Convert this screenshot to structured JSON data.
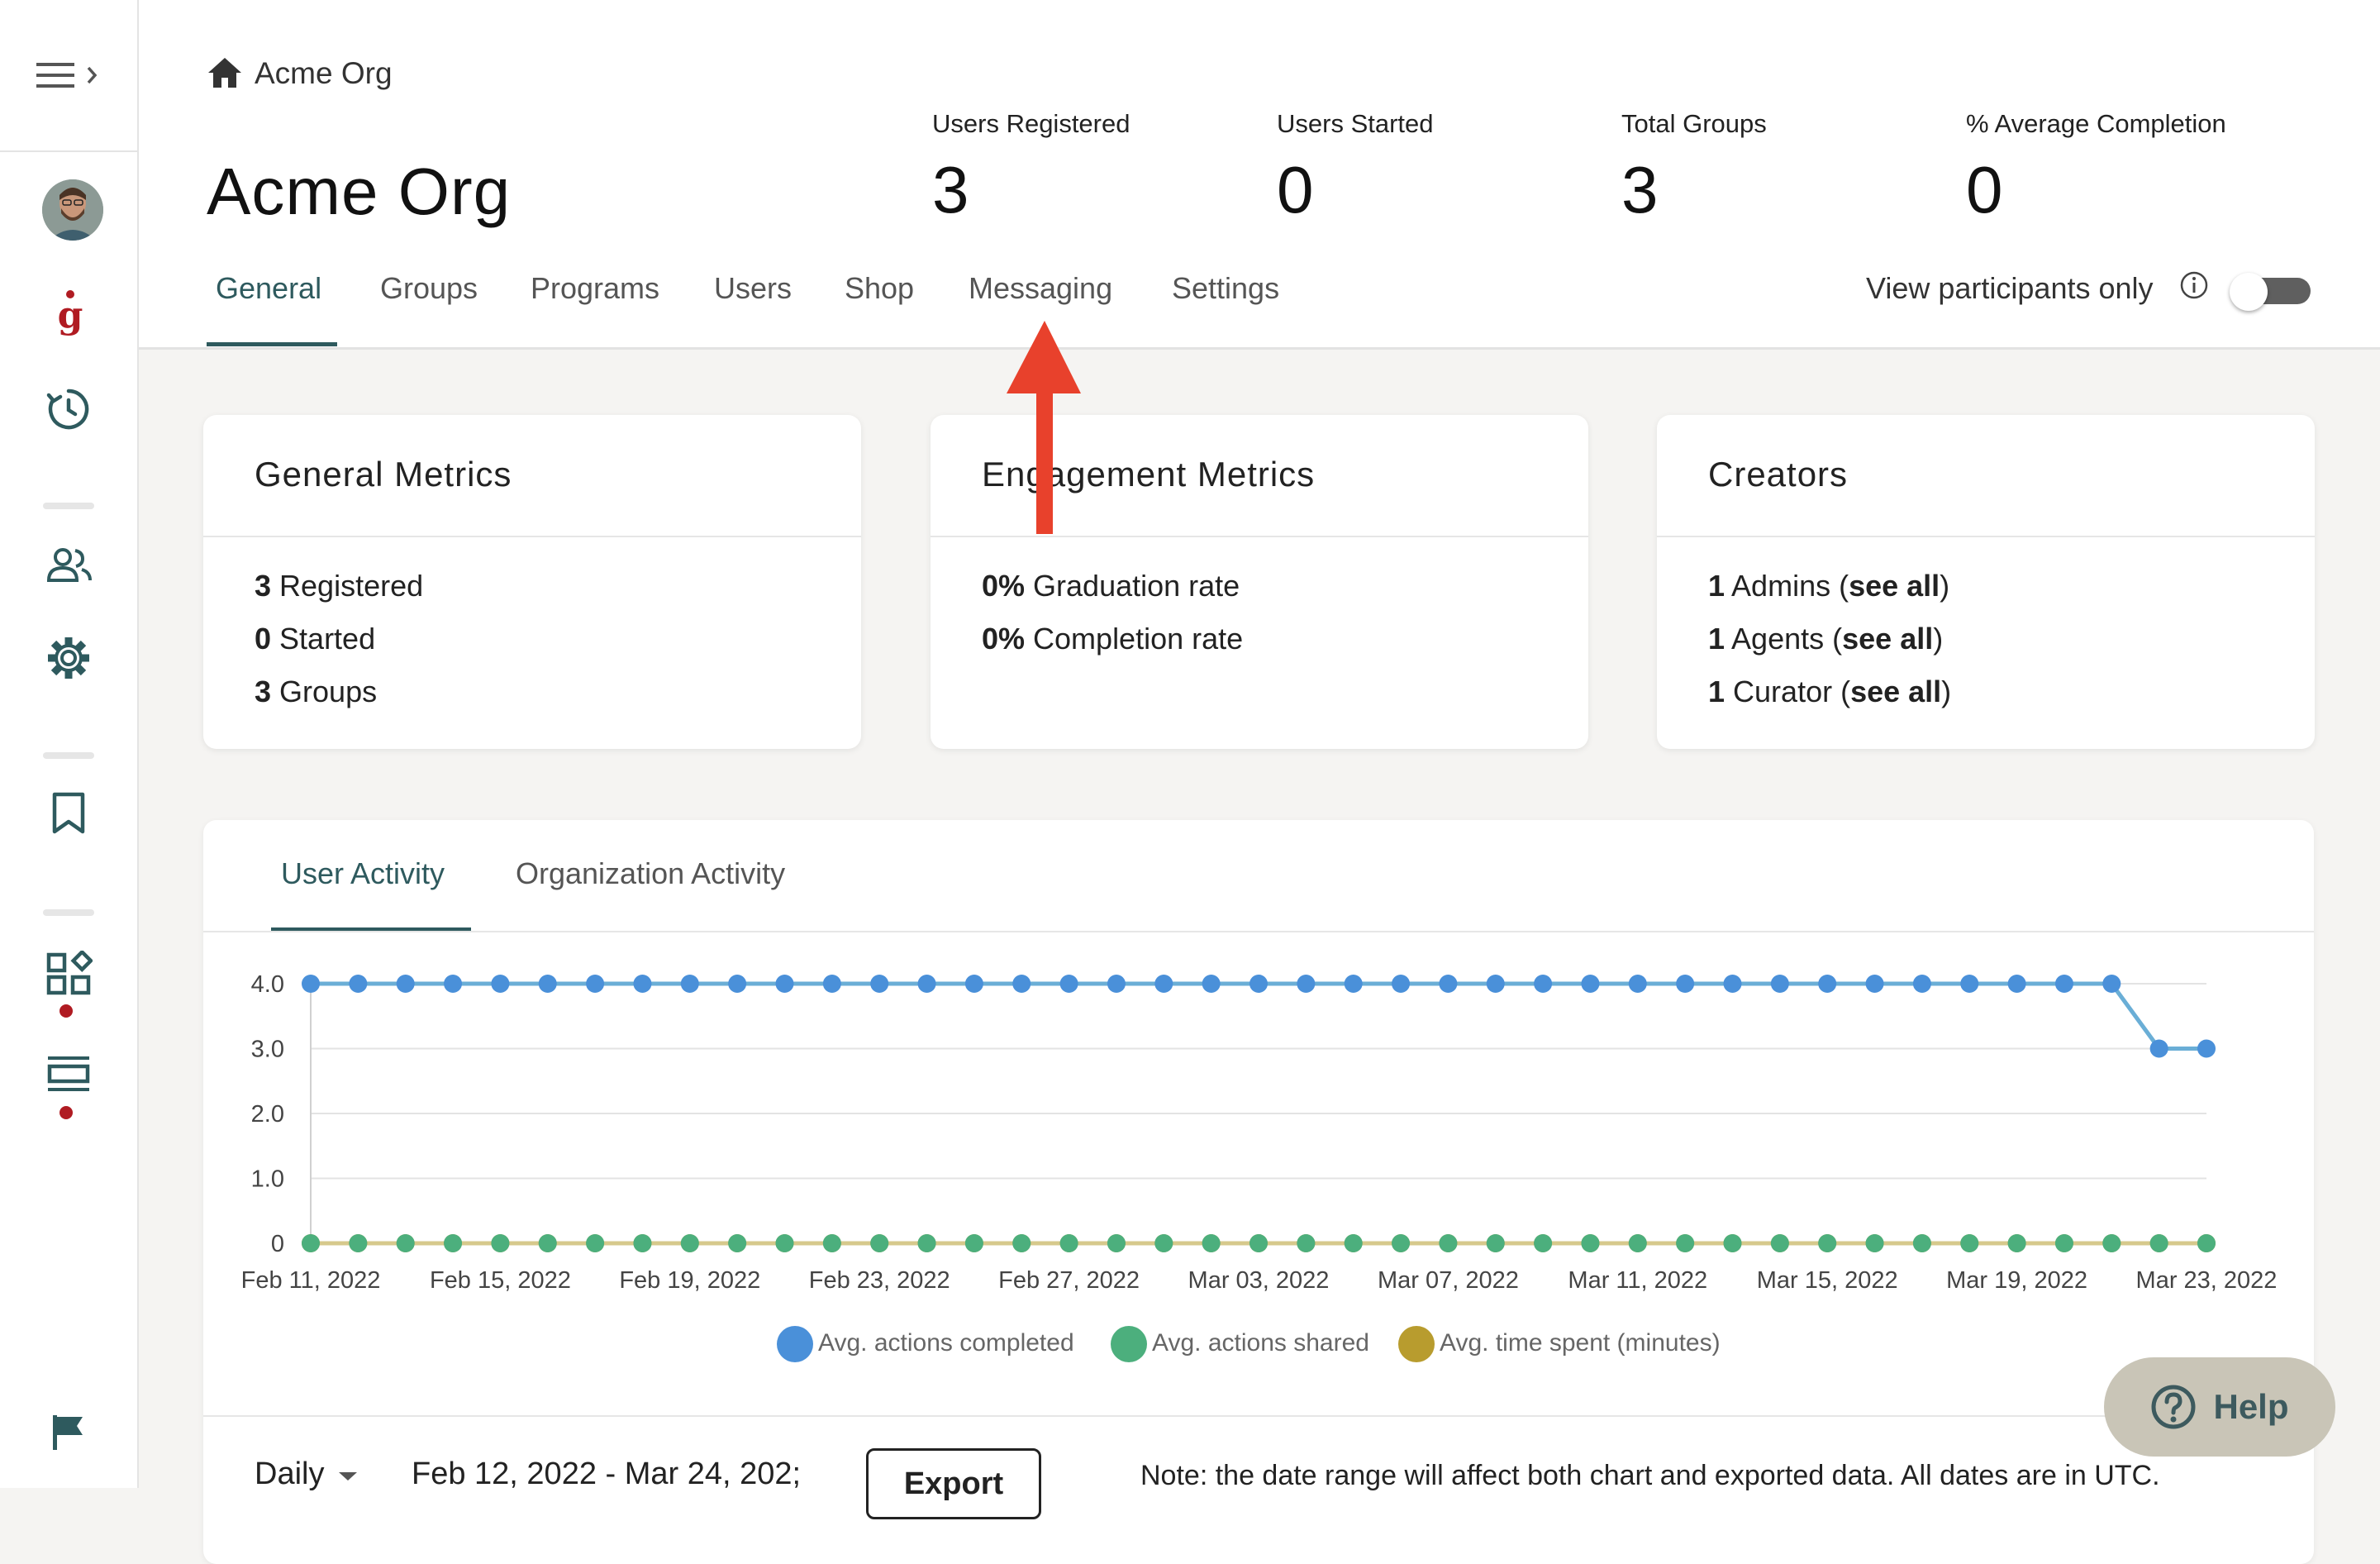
{
  "sidebar": {
    "menu_icon": "menu-expand-icon",
    "items": [
      {
        "name": "avatar"
      },
      {
        "name": "g-logo-icon"
      },
      {
        "name": "history-icon"
      },
      {
        "name": "people-icon"
      },
      {
        "name": "gear-icon"
      },
      {
        "name": "bookmark-icon"
      },
      {
        "name": "widgets-icon"
      },
      {
        "name": "layout-icon"
      },
      {
        "name": "flag-icon"
      }
    ],
    "accent": "#b01b22",
    "icon_color": "#2e5a5e"
  },
  "breadcrumb": {
    "icon": "home-icon",
    "label": "Acme Org"
  },
  "page_title": "Acme Org",
  "stats": [
    {
      "label": "Users Registered",
      "value": "3"
    },
    {
      "label": "Users Started",
      "value": "0"
    },
    {
      "label": "Total Groups",
      "value": "3"
    },
    {
      "label": "% Average Completion",
      "value": "0"
    }
  ],
  "tabs": [
    "General",
    "Groups",
    "Programs",
    "Users",
    "Shop",
    "Messaging",
    "Settings"
  ],
  "active_tab": "General",
  "participants_toggle": {
    "label": "View participants only",
    "info_icon": "info-icon",
    "on": false
  },
  "cards": {
    "general": {
      "title": "General Metrics",
      "lines": [
        {
          "num": "3",
          "text": " Registered"
        },
        {
          "num": "0",
          "text": " Started"
        },
        {
          "num": "3",
          "text": " Groups"
        }
      ]
    },
    "engagement": {
      "title": "Engagement Metrics",
      "lines": [
        {
          "num": "0%",
          "text": " Graduation rate"
        },
        {
          "num": "0%",
          "text": " Completion rate"
        }
      ]
    },
    "creators": {
      "title": "Creators",
      "lines": [
        {
          "num": "1",
          "text": " Admins  (",
          "link": "see all",
          "close": ")"
        },
        {
          "num": "1",
          "text": " Agents  (",
          "link": "see all",
          "close": ")"
        },
        {
          "num": "1",
          "text": " Curator  (",
          "link": "see all",
          "close": ")"
        }
      ]
    }
  },
  "activity_tabs": [
    "User Activity",
    "Organization Activity"
  ],
  "chart_data": {
    "type": "line",
    "x_start": "Feb 11, 2022",
    "x_end": "Mar 23, 2022",
    "x_tick_labels": [
      "Feb 11, 2022",
      "Feb 15, 2022",
      "Feb 19, 2022",
      "Feb 23, 2022",
      "Feb 27, 2022",
      "Mar 03, 2022",
      "Mar 07, 2022",
      "Mar 11, 2022",
      "Mar 15, 2022",
      "Mar 19, 2022",
      "Mar 23, 2022"
    ],
    "y_tick_labels": [
      "4.0",
      "3.0",
      "2.0",
      "1.0",
      "0"
    ],
    "ylim": [
      0,
      4
    ],
    "grid": true,
    "legend_position": "bottom",
    "series": [
      {
        "name": "Avg. actions completed",
        "color": "#4a90d9",
        "line_color": "#6aaed6",
        "values": [
          4,
          4,
          4,
          4,
          4,
          4,
          4,
          4,
          4,
          4,
          4,
          4,
          4,
          4,
          4,
          4,
          4,
          4,
          4,
          4,
          4,
          4,
          4,
          4,
          4,
          4,
          4,
          4,
          4,
          4,
          4,
          4,
          4,
          4,
          4,
          4,
          4,
          4,
          4,
          3,
          3
        ]
      },
      {
        "name": "Avg. actions shared",
        "color": "#4caf7d",
        "line_color": "#4caf7d",
        "values": [
          0,
          0,
          0,
          0,
          0,
          0,
          0,
          0,
          0,
          0,
          0,
          0,
          0,
          0,
          0,
          0,
          0,
          0,
          0,
          0,
          0,
          0,
          0,
          0,
          0,
          0,
          0,
          0,
          0,
          0,
          0,
          0,
          0,
          0,
          0,
          0,
          0,
          0,
          0,
          0,
          0
        ]
      },
      {
        "name": "Avg. time spent (minutes)",
        "color": "#b89c2e",
        "line_color": "#d6c98c",
        "values": [
          0,
          0,
          0,
          0,
          0,
          0,
          0,
          0,
          0,
          0,
          0,
          0,
          0,
          0,
          0,
          0,
          0,
          0,
          0,
          0,
          0,
          0,
          0,
          0,
          0,
          0,
          0,
          0,
          0,
          0,
          0,
          0,
          0,
          0,
          0,
          0,
          0,
          0,
          0,
          0,
          0
        ]
      }
    ]
  },
  "bottom": {
    "interval": "Daily",
    "date_range": "Feb 12, 2022 - Mar 24, 202;",
    "export_label": "Export",
    "note": "Note: the date range will affect both chart and exported data. All dates are in UTC."
  },
  "help_label": "Help",
  "annotation_arrow": {
    "color": "#e8412c",
    "icon": "arrow-up-icon"
  }
}
